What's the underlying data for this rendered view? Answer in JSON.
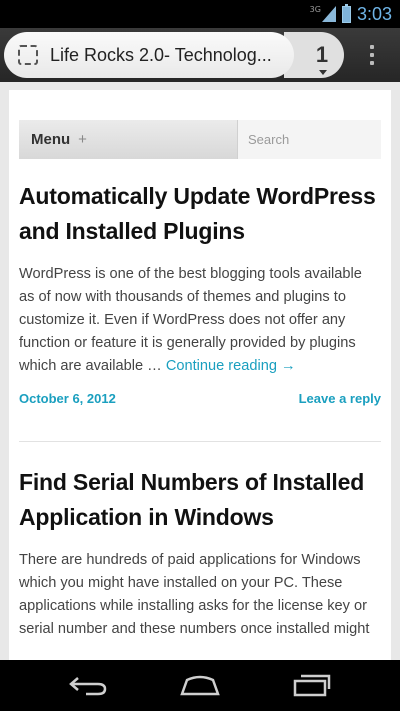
{
  "status_bar": {
    "network": "3G",
    "time": "3:03"
  },
  "browser": {
    "url_title": "Life Rocks 2.0- Technolog...",
    "tab_count": "1"
  },
  "nav": {
    "menu_label": "Menu",
    "menu_plus": "+",
    "search_placeholder": "Search"
  },
  "posts": [
    {
      "title": "Automatically Update WordPress and Installed Plugins",
      "excerpt": "WordPress is one of the best blogging tools available as of now with thousands of themes and plugins to customize it. Even if WordPress does not offer any function or feature it is generally provided by plugins which are available … ",
      "continue_label": "Continue reading →",
      "date": "October 6, 2012",
      "reply_label": "Leave a reply"
    },
    {
      "title": "Find Serial Numbers of Installed Application in Windows",
      "excerpt": "There are hundreds of paid applications for Windows which you might have installed on your PC. These applications while installing asks for the license key or serial number and these numbers once installed might"
    }
  ],
  "icons": {
    "signal": "signal-icon",
    "battery": "battery-icon",
    "favicon": "favicon-icon",
    "overflow": "overflow-menu-icon",
    "back": "back-icon",
    "home": "home-icon",
    "recents": "recents-icon"
  },
  "colors": {
    "accent": "#1a9fbf",
    "clock": "#6fb4e6"
  }
}
